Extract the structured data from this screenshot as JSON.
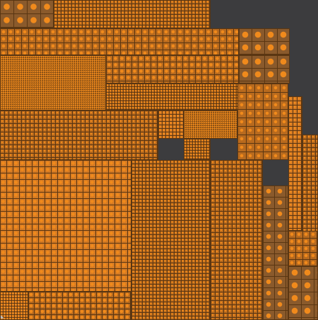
{
  "view": {
    "background_color": "#3c3c3e",
    "cell_border_color": "#5a3612",
    "cell_fill_color": "#b86a1e",
    "cell_fill_alt_color": "#d47a24",
    "marker_color": "#f08a1c",
    "large_cell_color": "#8a5a2c"
  },
  "icons": {
    "corner": "resize-grip-icon"
  }
}
